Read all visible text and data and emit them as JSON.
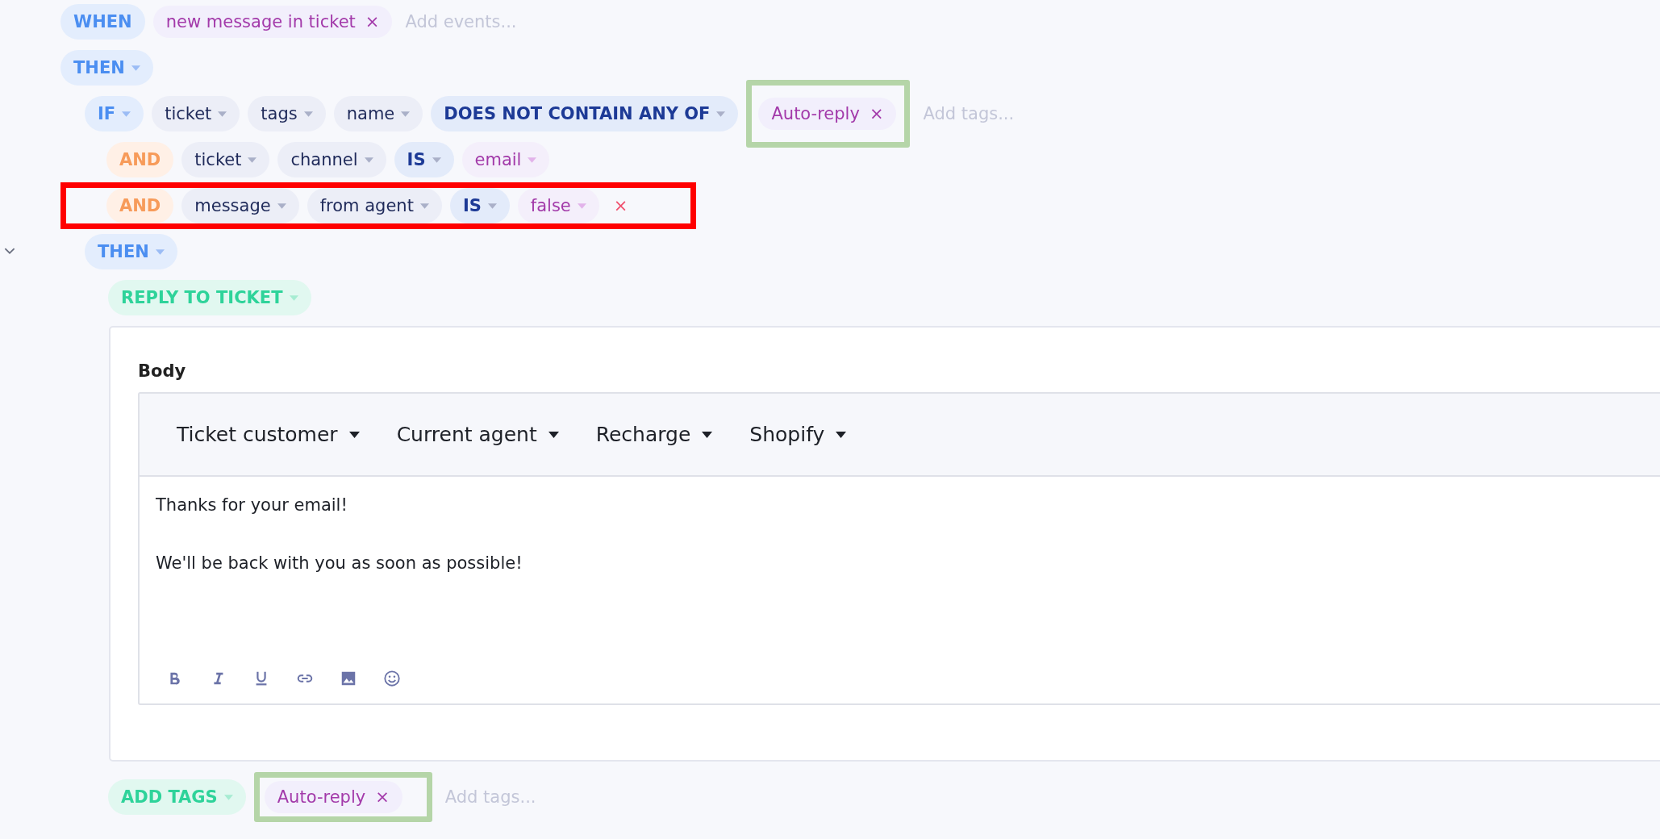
{
  "trigger": {
    "keyword": "WHEN",
    "events": [
      {
        "label": "new message in ticket",
        "remove": "×"
      }
    ],
    "placeholder": "Add events..."
  },
  "then_keyword": "THEN",
  "conditions": [
    {
      "kind": "if",
      "keyword": "IF",
      "parts": [
        {
          "kind": "field",
          "text": "ticket"
        },
        {
          "kind": "field",
          "text": "tags"
        },
        {
          "kind": "field",
          "text": "name"
        },
        {
          "kind": "operator",
          "text": "DOES NOT CONTAIN ANY OF"
        }
      ],
      "tags": [
        {
          "label": "Auto-reply",
          "remove": "×"
        }
      ],
      "tags_frame": {
        "color": "#b5d5a8"
      },
      "placeholder": "Add tags..."
    },
    {
      "kind": "and",
      "keyword": "AND",
      "parts": [
        {
          "kind": "field",
          "text": "ticket"
        },
        {
          "kind": "field",
          "text": "channel"
        },
        {
          "kind": "operator",
          "text": "IS"
        },
        {
          "kind": "value",
          "text": "email"
        }
      ]
    },
    {
      "kind": "and",
      "keyword": "AND",
      "parts": [
        {
          "kind": "field",
          "text": "message"
        },
        {
          "kind": "field",
          "text": "from agent"
        },
        {
          "kind": "operator",
          "text": "IS"
        },
        {
          "kind": "value",
          "text": "false"
        }
      ],
      "remove": "×",
      "frame": {
        "color": "#ff0000"
      }
    }
  ],
  "branch": {
    "keyword": "THEN",
    "expanded": true
  },
  "actions": [
    {
      "kind": "reply",
      "label": "REPLY TO TICKET",
      "body_label": "Body",
      "variables": [
        "Ticket customer",
        "Current agent",
        "Recharge",
        "Shopify"
      ],
      "paragraphs": [
        "Thanks for your email!",
        "We'll be back with you as soon as possible!"
      ]
    },
    {
      "kind": "tags",
      "label": "ADD TAGS",
      "tags": [
        {
          "label": "Auto-reply",
          "remove": "×"
        }
      ],
      "tags_frame": {
        "color": "#b5d5a8"
      },
      "placeholder": "Add tags..."
    }
  ]
}
